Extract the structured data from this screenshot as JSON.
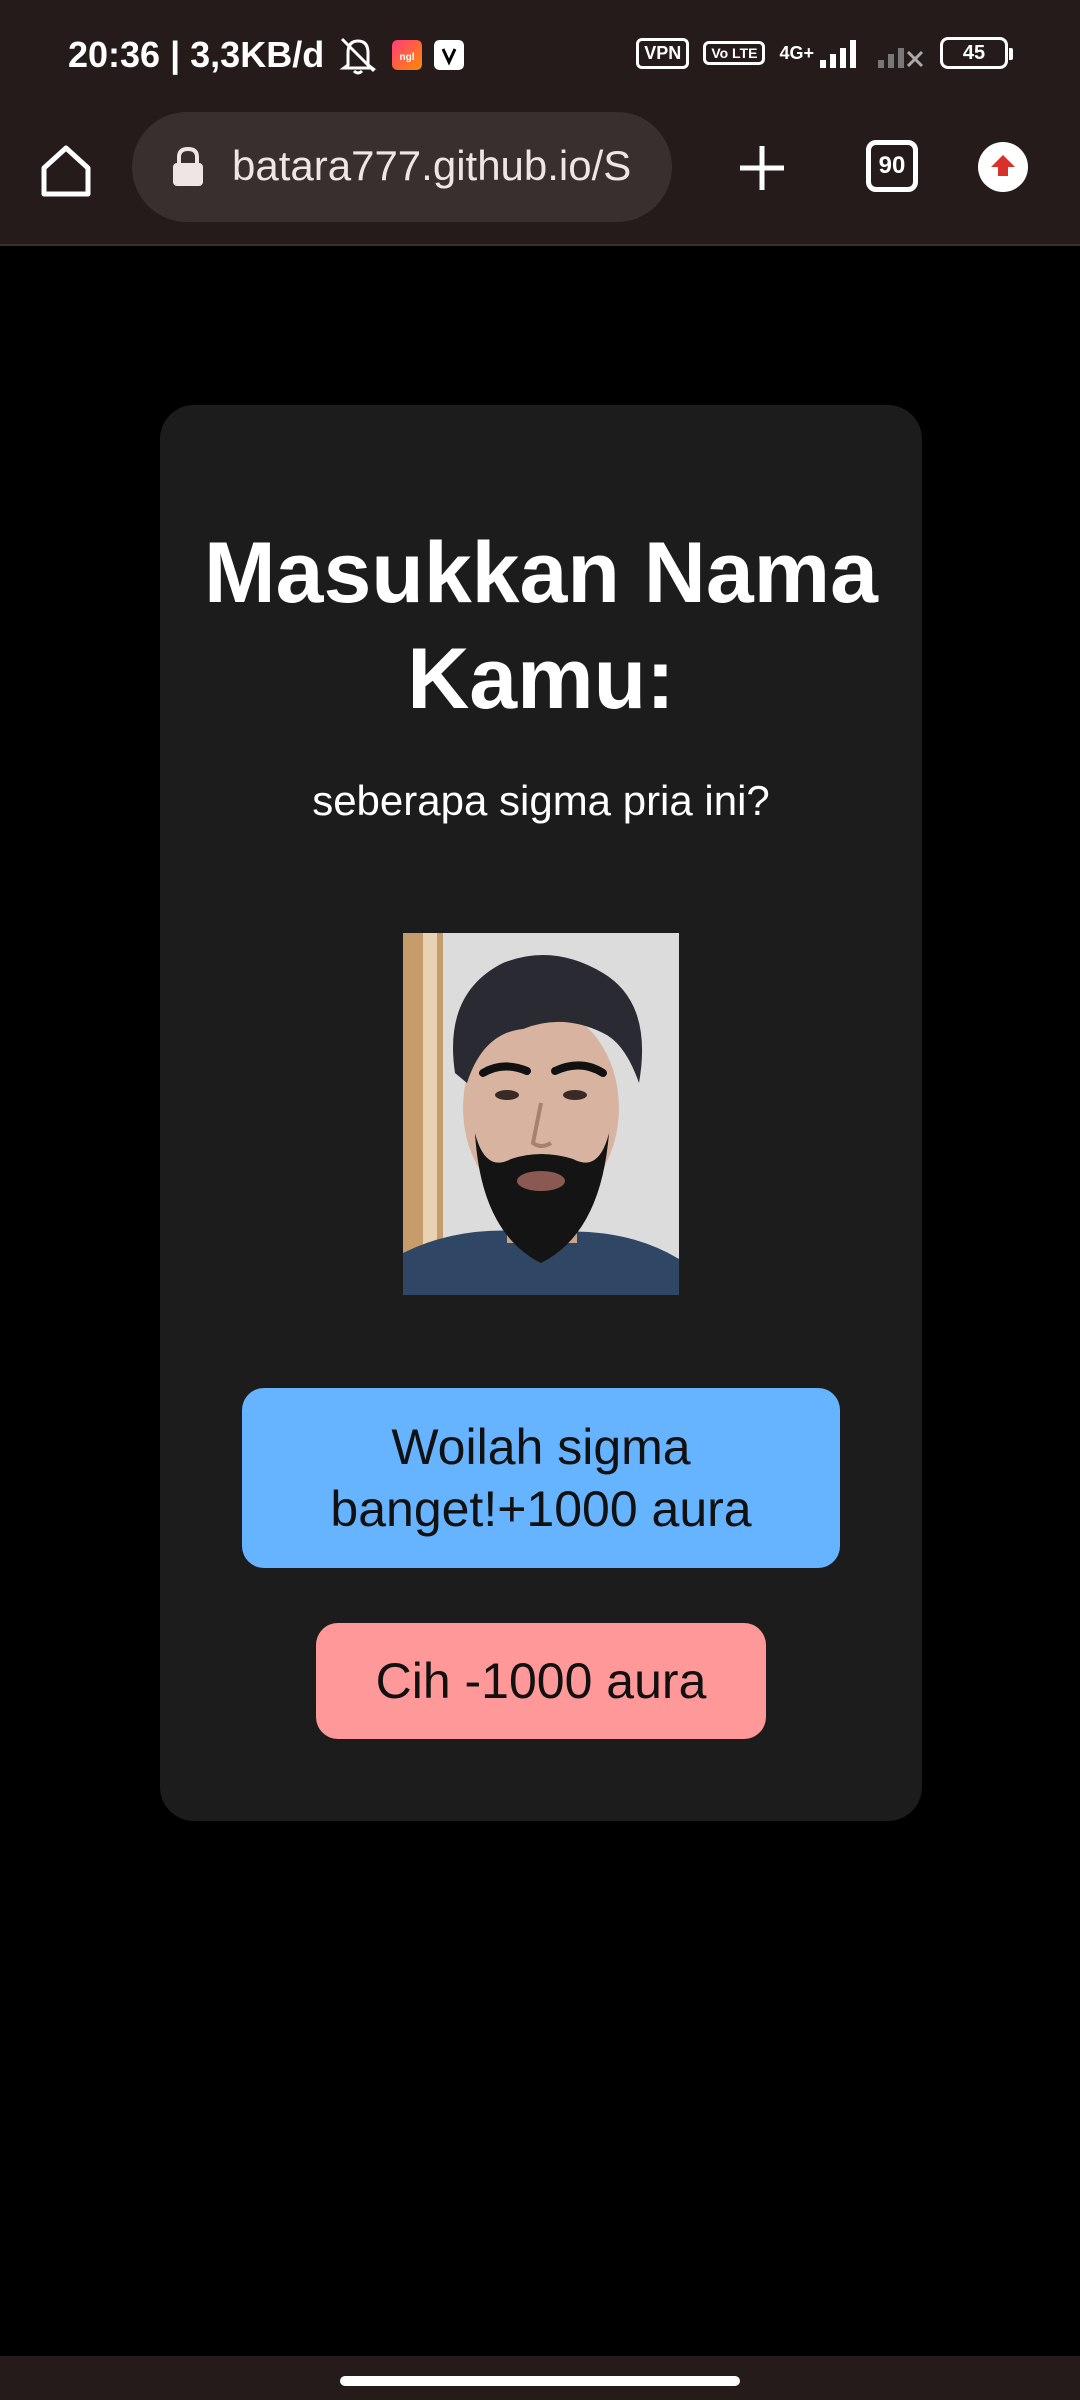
{
  "status_bar": {
    "time_speed": "20:36 | 3,3KB/d",
    "vpn_label": "VPN",
    "volte_label": "Vo LTE",
    "network_label": "4G+",
    "battery_level": "45",
    "icons": [
      "mute-icon",
      "ngl-app-icon",
      "notification-app-icon",
      "signal-icon",
      "signal-no-service-icon"
    ]
  },
  "browser": {
    "url": "batara777.github.io/S",
    "tab_count": "90",
    "icons": [
      "home-icon",
      "lock-icon",
      "plus-icon",
      "tabs-icon",
      "update-arrow-icon"
    ]
  },
  "page": {
    "title": "Masukkan Nama Kamu:",
    "subtitle": "seberapa sigma pria ini?",
    "button_sigma": "Woilah sigma banget!+1000 aura",
    "button_cih": "Cih -1000 aura"
  },
  "colors": {
    "background": "#000000",
    "card": "#1c1c1c",
    "button_sigma": "#66b3ff",
    "button_cih": "#ff9999",
    "chrome": "#261b1b"
  }
}
